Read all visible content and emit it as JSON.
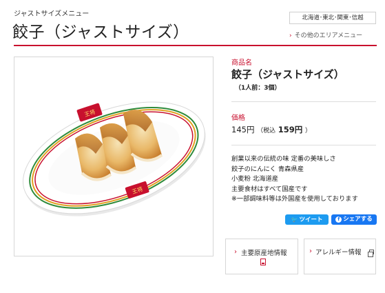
{
  "header": {
    "category": "ジャストサイズメニュー",
    "title": "餃子（ジャストサイズ）",
    "area_badge": "北海道･東北･関東･信越",
    "area_link": "その他のエリアメニュー"
  },
  "product": {
    "name_label": "商品名",
    "name": "餃子（ジャストサイズ）",
    "serving": "（1人前：3個）",
    "price_label": "価格",
    "price": "145円",
    "tax_label": "（税込",
    "tax_price": "159円",
    "tax_close": "）",
    "description": [
      "創業以来の伝統の味 定番の美味しさ",
      "餃子のにんにく 青森県産",
      "小麦粉 北海道産",
      "主要食材はすべて国産です",
      "※一部調味料等は外国産を使用しております"
    ]
  },
  "share": {
    "tweet": "ツイート",
    "share": "シェアする"
  },
  "links": {
    "origin": "主要原産地情報",
    "allergy": "アレルギー情報"
  },
  "plate_logo": "王将",
  "colors": {
    "accent_red": "#c8102e",
    "twitter_blue": "#1d9bf0",
    "facebook_blue": "#1877f2"
  }
}
